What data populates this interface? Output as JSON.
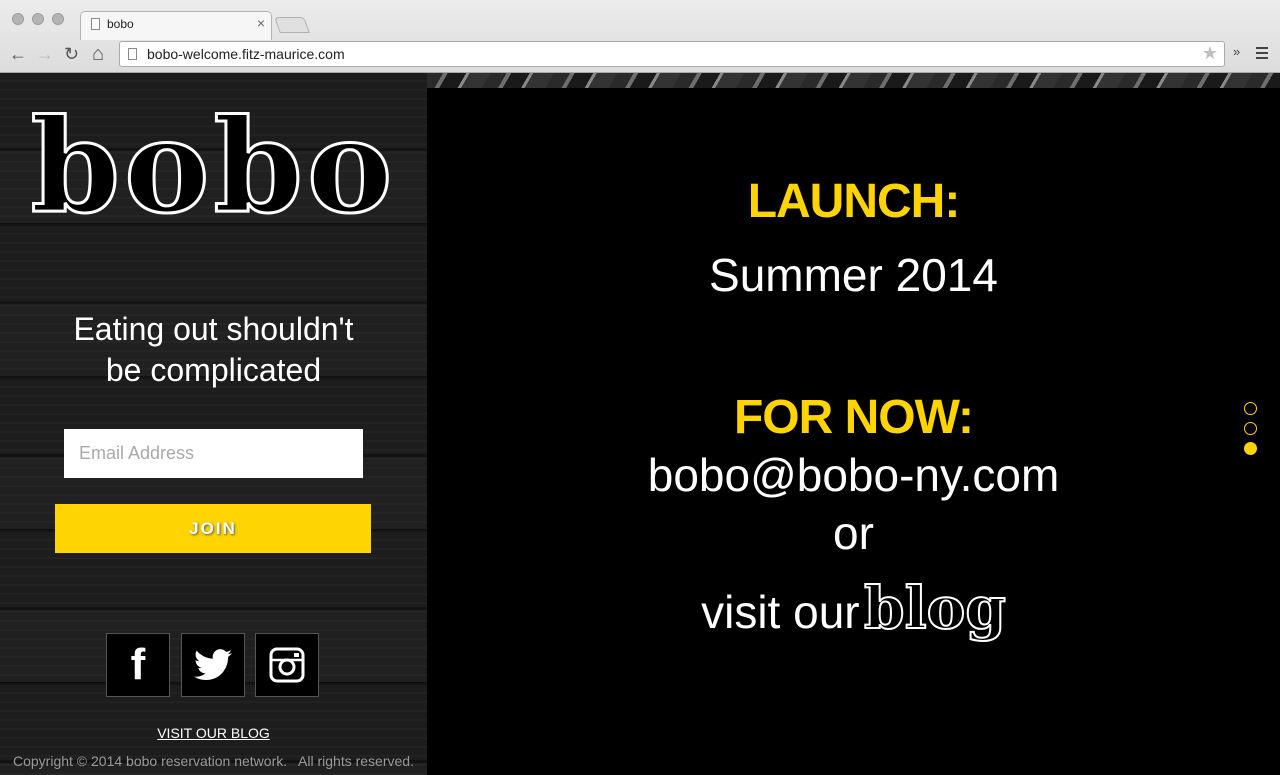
{
  "browser": {
    "tab_title": "bobo",
    "tab_close": "×",
    "url": "bobo-welcome.fitz-maurice.com",
    "back_glyph": "←",
    "forward_glyph": "→",
    "reload_glyph": "↻",
    "home_glyph": "⌂",
    "star_glyph": "★",
    "overflow_glyph": "»"
  },
  "sidebar": {
    "logo": "bobo",
    "tagline_line1": "Eating out shouldn't",
    "tagline_line2": "be complicated",
    "email_placeholder": "Email Address",
    "join_label": "JOIN",
    "social": [
      {
        "name": "facebook-icon",
        "glyph": "f"
      },
      {
        "name": "twitter-icon"
      },
      {
        "name": "instagram-icon"
      }
    ],
    "blog_link": "VISIT OUR BLOG",
    "copyright": "Copyright © 2014 bobo reservation network.   All rights reserved."
  },
  "main": {
    "launch_heading": "LAUNCH:",
    "launch_date": "Summer 2014",
    "fornow_heading": "FOR NOW:",
    "email": "bobo@bobo-ny.com",
    "or": "or",
    "visit_prefix": "visit our",
    "blog_word": "blog"
  },
  "pager": {
    "count": 3,
    "active_index": 2
  },
  "colors": {
    "accent": "#ffd400",
    "background": "#000000",
    "text": "#ffffff"
  }
}
